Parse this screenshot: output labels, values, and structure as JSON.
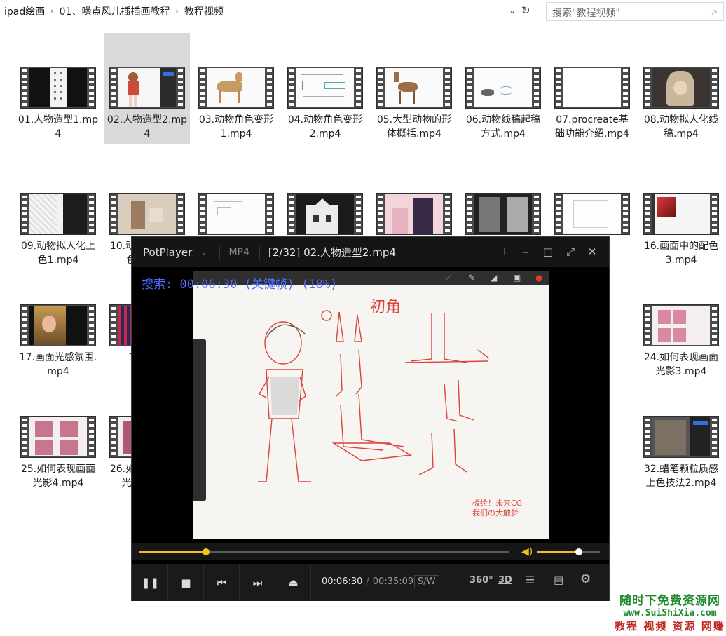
{
  "explorer": {
    "breadcrumbs": [
      "ipad绘画",
      "01、噪点风儿插插画教程",
      "教程视频"
    ],
    "search_placeholder": "搜索\"教程视频\""
  },
  "files": [
    {
      "name": "01.人物造型1.mp4"
    },
    {
      "name": "02.人物造型2.mp4",
      "selected": true
    },
    {
      "name": "03.动物角色变形1.mp4"
    },
    {
      "name": "04.动物角色变形2.mp4"
    },
    {
      "name": "05.大型动物的形体概括.mp4"
    },
    {
      "name": "06.动物线稿起稿方式.mp4"
    },
    {
      "name": "07.procreate基础功能介绍.mp4"
    },
    {
      "name": "08.动物拟人化线稿.mp4"
    },
    {
      "name": "09.动物拟人化上色1.mp4"
    },
    {
      "name": "10.动物拟人化上色2.mp4"
    },
    {
      "name": "16.画面中的配色3.mp4"
    },
    {
      "name": "17.画面光感氛围.mp4"
    },
    {
      "name": "18.mp4"
    },
    {
      "name": "24.如何表现画面光影3.mp4"
    },
    {
      "name": "25.如何表现画面光影4.mp4"
    },
    {
      "name": "26.如何表现画面光影5.mp4"
    },
    {
      "name": "32.蜡笔颗粒质感上色技法2.mp4"
    }
  ],
  "player": {
    "app_name": "PotPlayer",
    "format": "MP4",
    "title": "[2/32] 02.人物造型2.mp4",
    "osd": "搜索: 00:06:30 (关键帧) (18%)",
    "current_time": "00:06:30",
    "duration": "00:35:09",
    "sw_label": "S/W",
    "progress_fraction": 0.18,
    "volume_fraction": 0.67,
    "art_title": "初角",
    "art_caption_1": "板绘！未来CG",
    "art_caption_2": "我们の大触梦",
    "icon_360": "360°",
    "icon_3d": "3D"
  },
  "watermark": {
    "line1": "随时下免费资源网",
    "line2": "www.SuiShiXia.com",
    "line3": "教程 视频 资源 网赚"
  },
  "colors": {
    "accent": "#f0c020",
    "osd": "#4f6bff",
    "watermark_green": "#1e8b2f",
    "watermark_red": "#c0271e"
  }
}
